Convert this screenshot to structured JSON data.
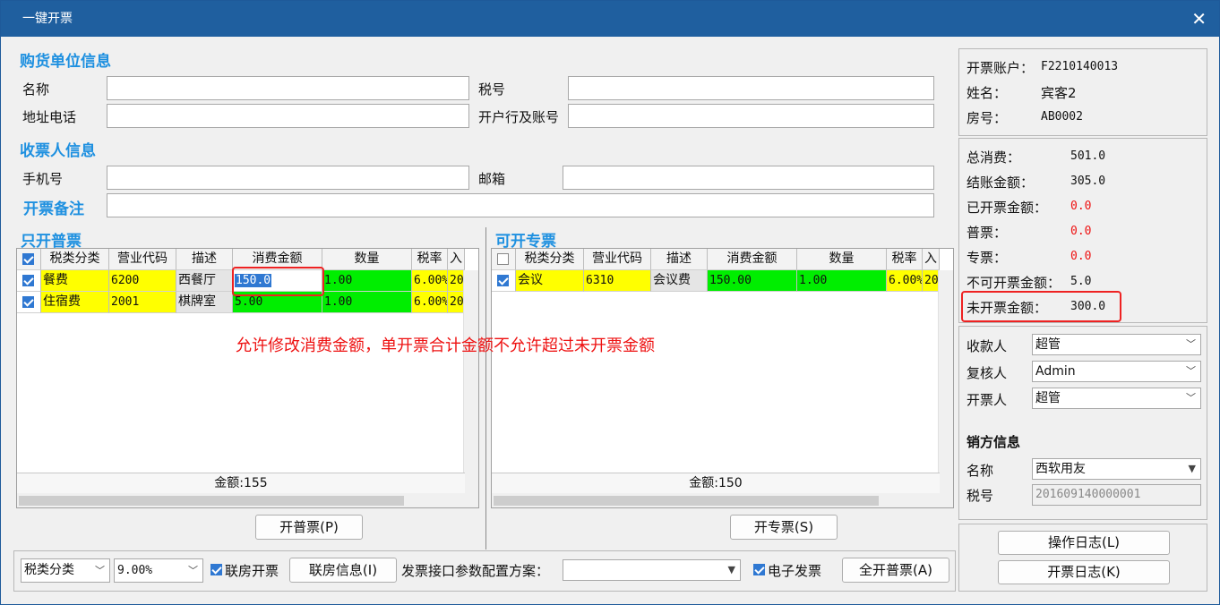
{
  "window": {
    "title": "一键开票"
  },
  "buyer": {
    "section": "购货单位信息",
    "name_label": "名称",
    "tax_label": "税号",
    "addr_label": "地址电话",
    "bank_label": "开户行及账号"
  },
  "receiver": {
    "section": "收票人信息",
    "phone_label": "手机号",
    "email_label": "邮箱",
    "remark_label": "开票备注"
  },
  "normal": {
    "section": "只开普票",
    "headers": [
      "税类分类",
      "营业代码",
      "描述",
      "消费金额",
      "数量",
      "税率",
      "入"
    ],
    "rows": [
      {
        "cat": "餐费",
        "code": "6200",
        "desc": "西餐厅",
        "amount": "150.0",
        "qty": "1.00",
        "rate": "6.00%",
        "extra": "20"
      },
      {
        "cat": "住宿费",
        "code": "2001",
        "desc": "棋牌室",
        "amount": "5.00",
        "qty": "1.00",
        "rate": "6.00%",
        "extra": "20"
      }
    ],
    "total": "金额:155",
    "button": "开普票(P)"
  },
  "special": {
    "section": "可开专票",
    "headers": [
      "税类分类",
      "营业代码",
      "描述",
      "消费金额",
      "数量",
      "税率",
      "入"
    ],
    "rows": [
      {
        "cat": "会议",
        "code": "6310",
        "desc": "会议费",
        "amount": "150.00",
        "qty": "1.00",
        "rate": "6.00%",
        "extra": "20"
      }
    ],
    "total": "金额:150",
    "button": "开专票(S)"
  },
  "annotation": "允许修改消费金额，单开票合计金额不允许超过未开票金额",
  "account": {
    "acct_label": "开票账户：",
    "acct": "F2210140013",
    "name_label": "姓名：",
    "name": "宾客2",
    "room_label": "房号：",
    "room": "AB0002"
  },
  "summary": {
    "total_label": "总消费：",
    "total": "501.0",
    "settle_label": "结账金额：",
    "settle": "305.0",
    "issued_label": "已开票金额：",
    "issued": "0.0",
    "normal_label": "普票：",
    "normal": "0.0",
    "special_label": "专票：",
    "special": "0.0",
    "noninv_label": "不可开票金额：",
    "noninv": "5.0",
    "uninv_label": "未开票金额：",
    "uninv": "300.0"
  },
  "people": {
    "payee_label": "收款人",
    "payee": "超管",
    "reviewer_label": "复核人",
    "reviewer": "Admin",
    "drawer_label": "开票人",
    "drawer": "超管"
  },
  "seller": {
    "section": "销方信息",
    "name_label": "名称",
    "name": "西软用友",
    "tax_label": "税号",
    "tax": "201609140000001"
  },
  "logs": {
    "op": "操作日志(L)",
    "inv": "开票日志(K)"
  },
  "bottom": {
    "cat": "税类分类",
    "rate": "9.00%",
    "link_room": "联房开票",
    "link_info": "联房信息(I)",
    "config_label": "发票接口参数配置方案：",
    "config_value": "",
    "einvoice": "电子发票",
    "all_normal": "全开普票(A)"
  },
  "colors": {
    "title_bar": "#1f5f9f",
    "section": "#1e90e0",
    "highlight": "#ee2222"
  }
}
